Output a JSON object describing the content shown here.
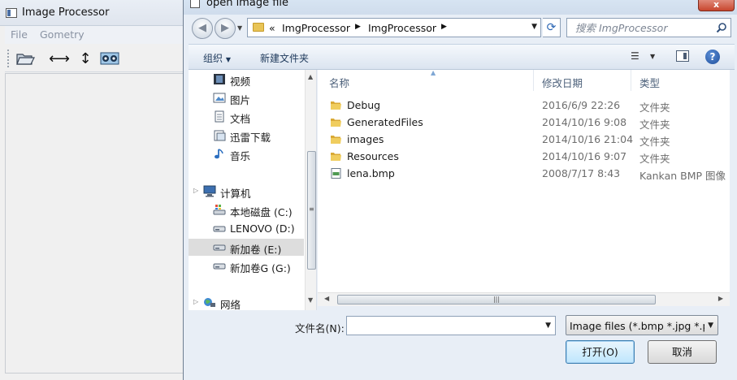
{
  "background_window": {
    "title": "Image Processor",
    "menu": [
      "File",
      "Gometry"
    ],
    "toolbar_icons": [
      "open-folder-icon",
      "horizontal-resize-icon",
      "vertical-resize-icon",
      "image-compare-icon"
    ]
  },
  "dialog": {
    "title": "open image file",
    "close_label": "x",
    "address": {
      "crumbs": [
        "«",
        "ImgProcessor",
        "ImgProcessor"
      ]
    },
    "search": {
      "placeholder": "搜索 ImgProcessor"
    },
    "commandbar": {
      "organize": "组织",
      "new_folder": "新建文件夹"
    },
    "nav_items": [
      {
        "label": "视频",
        "icon": "video-icon"
      },
      {
        "label": "图片",
        "icon": "pictures-icon"
      },
      {
        "label": "文档",
        "icon": "documents-icon"
      },
      {
        "label": "迅雷下载",
        "icon": "download-folder-icon"
      },
      {
        "label": "音乐",
        "icon": "music-icon"
      },
      {
        "label": "计算机",
        "icon": "computer-icon"
      },
      {
        "label": "本地磁盘 (C:)",
        "icon": "system-drive-icon"
      },
      {
        "label": "LENOVO (D:)",
        "icon": "drive-icon"
      },
      {
        "label": "新加卷 (E:)",
        "icon": "drive-icon",
        "selected": true
      },
      {
        "label": "新加卷G (G:)",
        "icon": "drive-icon"
      },
      {
        "label": "网络",
        "icon": "network-icon"
      }
    ],
    "columns": {
      "name": "名称",
      "date": "修改日期",
      "type": "类型"
    },
    "files": [
      {
        "name": "Debug",
        "date": "2016/6/9 22:26",
        "type": "文件夹",
        "icon": "folder-icon"
      },
      {
        "name": "GeneratedFiles",
        "date": "2014/10/16 9:08",
        "type": "文件夹",
        "icon": "folder-icon"
      },
      {
        "name": "images",
        "date": "2014/10/16 21:04",
        "type": "文件夹",
        "icon": "folder-icon"
      },
      {
        "name": "Resources",
        "date": "2014/10/16 9:07",
        "type": "文件夹",
        "icon": "folder-icon"
      },
      {
        "name": "lena.bmp",
        "date": "2008/7/17 8:43",
        "type": "Kankan BMP 图像",
        "icon": "bmp-file-icon"
      }
    ],
    "filename": {
      "label": "文件名(N):",
      "value": ""
    },
    "filter": {
      "selected": "Image files (*.bmp *.jpg *.pbm"
    },
    "buttons": {
      "open": "打开(O)",
      "cancel": "取消"
    }
  },
  "colors": {
    "dialog_bg": "#e8eef6",
    "folder_yellow": "#e8c456",
    "link_text": "#1e395b"
  }
}
